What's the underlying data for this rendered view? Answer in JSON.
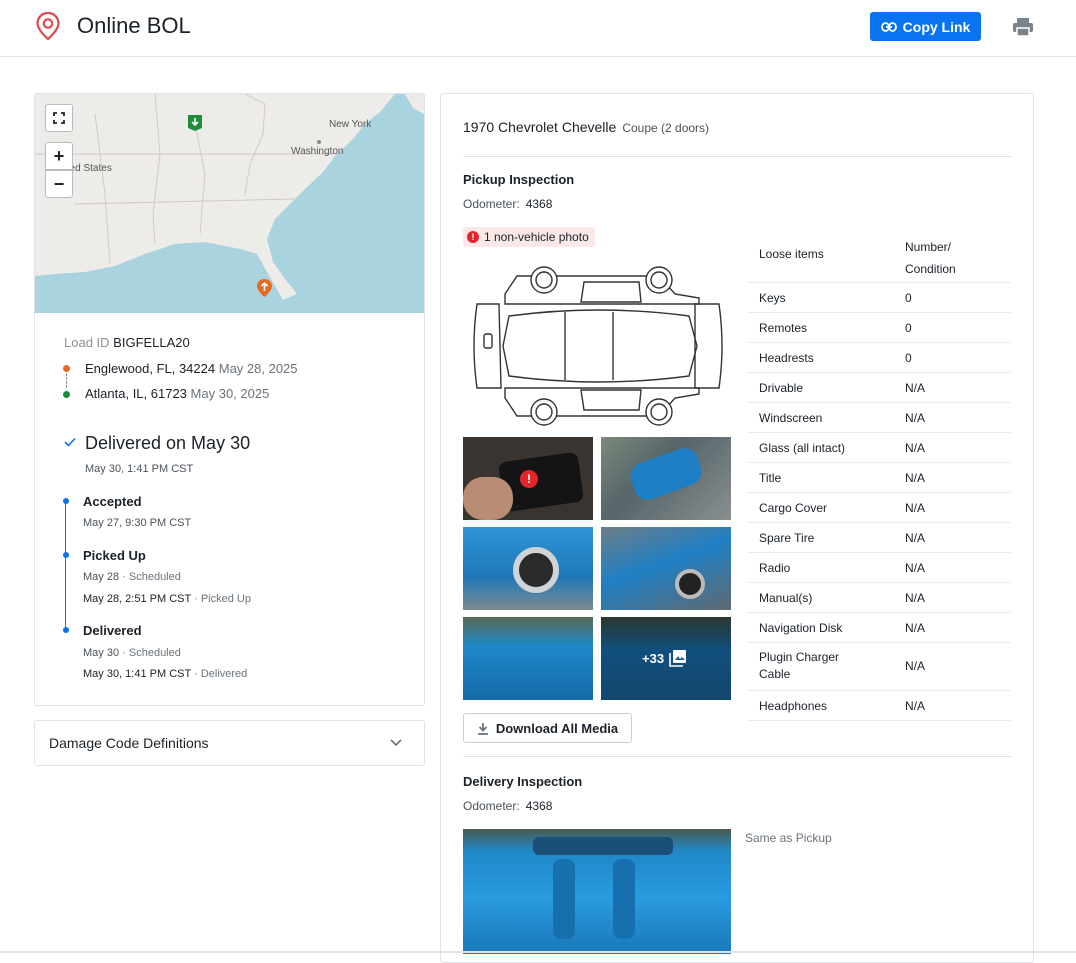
{
  "header": {
    "title": "Online BOL",
    "copy_link_label": "Copy Link"
  },
  "map": {
    "labels": [
      "New York",
      "Washington",
      "nited States"
    ]
  },
  "load": {
    "id_label": "Load ID",
    "id": "BIGFELLA20",
    "origin": {
      "place": "Englewood, FL, 34224",
      "date": "May 28, 2025"
    },
    "destination": {
      "place": "Atlanta, IL, 61723",
      "date": "May 30, 2025"
    }
  },
  "status": {
    "title": "Delivered on May 30",
    "time": "May 30, 1:41 PM CST"
  },
  "timeline": [
    {
      "label": "Accepted",
      "lines": [
        {
          "main": "May 27, 9:30 PM CST",
          "note": ""
        }
      ]
    },
    {
      "label": "Picked Up",
      "lines": [
        {
          "main": "May 28",
          "note": "Scheduled"
        },
        {
          "main": "May 28, 2:51 PM CST",
          "note": "Picked Up"
        }
      ]
    },
    {
      "label": "Delivered",
      "lines": [
        {
          "main": "May 30",
          "note": "Scheduled"
        },
        {
          "main": "May 30, 1:41 PM CST",
          "note": "Delivered"
        }
      ]
    }
  ],
  "damage": {
    "label": "Damage Code Definitions"
  },
  "vehicle": {
    "name": "1970 Chevrolet Chevelle",
    "body": "Coupe (2 doors)"
  },
  "pickup": {
    "title": "Pickup Inspection",
    "odometer_label": "Odometer:",
    "odometer": "4368",
    "warning": "1 non-vehicle photo",
    "more_photos": "+33",
    "download_label": "Download All Media"
  },
  "loose_items": {
    "header_item": "Loose items",
    "header_value": "Number/ Condition",
    "rows": [
      {
        "item": "Keys",
        "value": "0"
      },
      {
        "item": "Remotes",
        "value": "0"
      },
      {
        "item": "Headrests",
        "value": "0"
      },
      {
        "item": "Drivable",
        "value": "N/A"
      },
      {
        "item": "Windscreen",
        "value": "N/A"
      },
      {
        "item": "Glass (all intact)",
        "value": "N/A"
      },
      {
        "item": "Title",
        "value": "N/A"
      },
      {
        "item": "Cargo Cover",
        "value": "N/A"
      },
      {
        "item": "Spare Tire",
        "value": "N/A"
      },
      {
        "item": "Radio",
        "value": "N/A"
      },
      {
        "item": "Manual(s)",
        "value": "N/A"
      },
      {
        "item": "Navigation Disk",
        "value": "N/A"
      },
      {
        "item": "Plugin Charger Cable",
        "value": "N/A"
      },
      {
        "item": "Headphones",
        "value": "N/A"
      }
    ]
  },
  "delivery": {
    "title": "Delivery Inspection",
    "odometer_label": "Odometer:",
    "odometer": "4368",
    "same_as": "Same as Pickup"
  }
}
